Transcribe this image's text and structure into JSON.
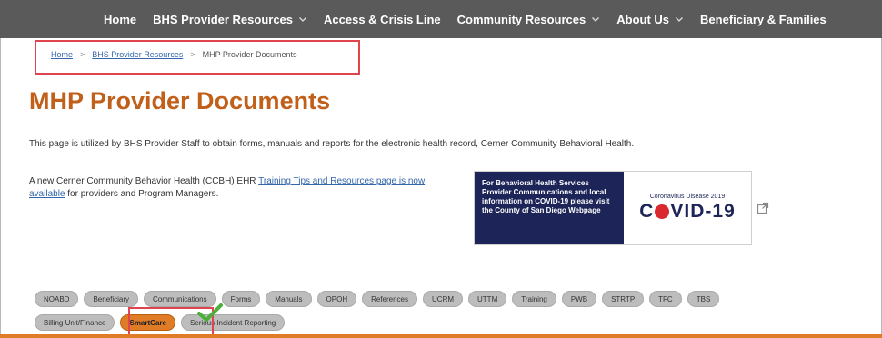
{
  "nav": {
    "items": [
      {
        "label": "Home",
        "has_dropdown": false
      },
      {
        "label": "BHS Provider Resources",
        "has_dropdown": true
      },
      {
        "label": "Access & Crisis Line",
        "has_dropdown": false
      },
      {
        "label": "Community Resources",
        "has_dropdown": true
      },
      {
        "label": "About Us",
        "has_dropdown": true
      },
      {
        "label": "Beneficiary & Families",
        "has_dropdown": false
      }
    ]
  },
  "breadcrumb": {
    "home": "Home",
    "section": "BHS Provider Resources",
    "current": "MHP Provider Documents",
    "separator": ">"
  },
  "page": {
    "title": "MHP Provider Documents",
    "intro": "This page is utilized by BHS Provider Staff to obtain forms, manuals and reports for the electronic health record, Cerner Community Behavioral Health.",
    "ccbh_prefix": "A new Cerner Community Behavior Health (CCBH) EHR ",
    "ccbh_link": "Training Tips and Resources page is now available",
    "ccbh_suffix": " for providers and Program Managers."
  },
  "banner": {
    "left_text": "For Behavioral Health Services Provider Communications and local information on COVID-19 please visit the County of San Diego Webpage",
    "covid_sub": "Coronavirus Disease 2019",
    "covid_prefix": "C",
    "covid_suffix": "VID-19"
  },
  "tabs": {
    "row1": [
      "NOABD",
      "Beneficiary",
      "Communications",
      "Forms",
      "Manuals",
      "OPOH",
      "References",
      "UCRM",
      "UTTM",
      "Training",
      "PWB",
      "STRTP",
      "TFC",
      "TBS"
    ],
    "row2": [
      "Billing Unit/Finance",
      "SmartCare",
      "Serious Incident Reporting"
    ],
    "active": "SmartCare"
  },
  "colors": {
    "nav_bg": "#5a5a5a",
    "title": "#c0601a",
    "accent_orange": "#e07c26",
    "highlight_box": "#e0454f",
    "covid_navy": "#1c2458",
    "check_green": "#4caf3a"
  },
  "icons": [
    "chevron-down-icon",
    "external-link-icon",
    "check-mark-icon",
    "virus-icon"
  ]
}
